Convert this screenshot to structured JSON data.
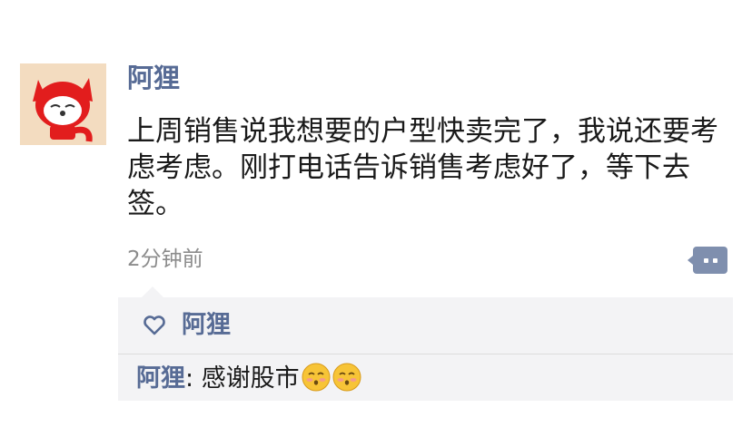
{
  "post": {
    "author": "阿狸",
    "text": "上周销售说我想要的户型快卖完了，我说还要考虑考虑。刚打电话告诉销售考虑好了，等下去签。",
    "time": "2分钟前"
  },
  "icons": {
    "avatar": "fox-avatar-icon",
    "comment": "comment-dots-icon",
    "like": "heart-outline-icon",
    "emoji": "blush-face-emoji"
  },
  "likes": {
    "names": "阿狸"
  },
  "comments": [
    {
      "author": "阿狸",
      "separator": ": ",
      "text": "感谢股市"
    }
  ],
  "colors": {
    "link": "#576b95",
    "text": "#1a1a1a",
    "muted": "#8c8c8c",
    "panel": "#f3f3f5",
    "accent": "#7f8fae"
  }
}
